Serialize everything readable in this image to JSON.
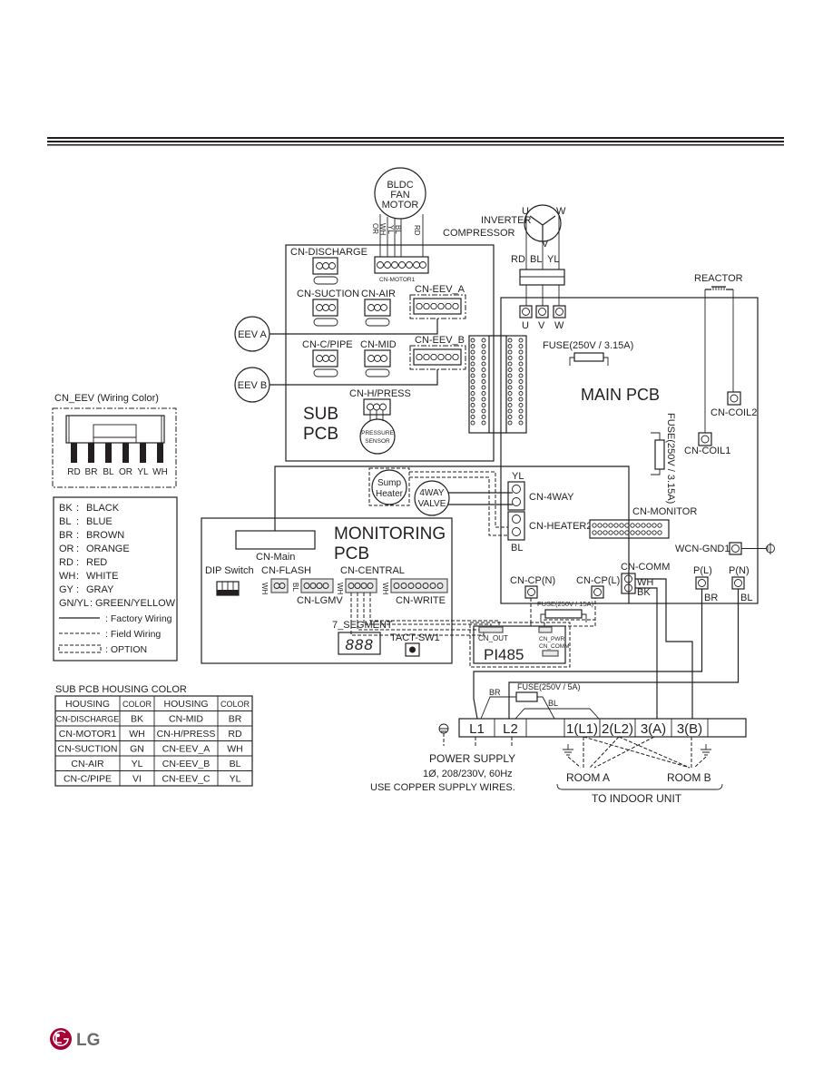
{
  "fan_motor": {
    "l1": "BLDC",
    "l2": "FAN",
    "l3": "MOTOR",
    "wires": [
      "OR",
      "WH",
      "YL",
      "BL",
      "RD"
    ]
  },
  "compressor": {
    "l1": "INVERTER",
    "l2": "COMPRESSOR",
    "u": "U",
    "v": "V",
    "w": "W",
    "wires": [
      "RD",
      "BL",
      "YL"
    ],
    "terminals": [
      "U",
      "V",
      "W"
    ]
  },
  "sub_pcb": {
    "title1": "SUB",
    "title2": "PCB",
    "cn_discharge": "CN-DISCHARGE",
    "cn_motor1": "CN-MOTOR1",
    "cn_suction": "CN-SUCTION",
    "cn_air": "CN-AIR",
    "cn_eev_a": "CN-EEV_A",
    "cn_cpipe": "CN-C/PIPE",
    "cn_mid": "CN-MID",
    "cn_eev_b": "CN-EEV_B",
    "cn_hpress": "CN-H/PRESS",
    "pressure1": "PRESSURE",
    "pressure2": "SENSOR"
  },
  "eev": {
    "a": "EEV A",
    "b": "EEV B"
  },
  "main_pcb": {
    "title": "MAIN PCB",
    "fuse1": "FUSE(250V / 3.15A)",
    "fuse2": "FUSE(250V / 3.15A)",
    "reactor": "REACTOR",
    "cn_coil1": "CN-COIL1",
    "cn_coil2": "CN-COIL2",
    "cn_4way": "CN-4WAY",
    "cn_heater2": "CN-HEATER2",
    "yl": "YL",
    "bl": "BL",
    "cn_monitor": "CN-MONITOR",
    "wcn_gnd1": "WCN-GND1",
    "cn_cpn": "CN-CP(N)",
    "cn_cpl": "CN-CP(L)",
    "fuse3": "FUSE(250V / 15A)",
    "cn_comm": "CN-COMM",
    "wh": "WH",
    "bk": "BK",
    "pl": "P(L)",
    "pn": "P(N)",
    "br": "BR",
    "bl2": "BL"
  },
  "sump": {
    "l1": "Sump",
    "l2": "Heater"
  },
  "valve": {
    "l1": "4WAY",
    "l2": "VALVE"
  },
  "monitoring_pcb": {
    "title1": "MONITORING",
    "title2": "PCB",
    "cn_main": "CN-Main",
    "dip": "DIP Switch",
    "cn_flash": "CN-FLASH",
    "cn_lgmv": "CN-LGMV",
    "cn_central": "CN-CENTRAL",
    "cn_write": "CN-WRITE",
    "wh": "WH",
    "bl": "BL",
    "seg_label": "7_SEGMENT",
    "seg_display": "888",
    "tact": "TACT-SW1"
  },
  "pi485": {
    "title": "PI485",
    "cn_out": "CN_OUT",
    "cn_pwr": "CN_PWR",
    "cn_comm": "CN_COMM"
  },
  "terminal": {
    "cells": [
      "L1",
      "L2",
      "",
      "1(L1)",
      "2(L2)",
      "3(A)",
      "3(B)",
      ""
    ],
    "fuse": "FUSE(250V / 5A)",
    "br": "BR",
    "bl": "BL",
    "power1": "POWER SUPPLY",
    "power2": "1Ø, 208/230V, 60Hz",
    "power3": "USE COPPER SUPPLY WIRES.",
    "room_a": "ROOM A",
    "room_b": "ROOM B",
    "indoor": "TO INDOOR UNIT"
  },
  "cn_eev_legend": {
    "title": "CN_EEV (Wiring Color)",
    "wires": [
      "RD",
      "BR",
      "BL",
      "OR",
      "YL",
      "WH"
    ]
  },
  "color_legend": [
    {
      "code": "BK",
      "name": "BLACK"
    },
    {
      "code": "BL",
      "name": "BLUE"
    },
    {
      "code": "BR",
      "name": "BROWN"
    },
    {
      "code": "OR",
      "name": "ORANGE"
    },
    {
      "code": "RD",
      "name": "RED"
    },
    {
      "code": "WH",
      "name": "WHITE"
    },
    {
      "code": "GY",
      "name": "GRAY"
    },
    {
      "code": "GN/YL",
      "name": "GREEN/YELLOW"
    }
  ],
  "line_legend": {
    "factory": ": Factory Wiring",
    "field": ": Field Wiring",
    "option": ": OPTION"
  },
  "housing_table": {
    "title": "SUB PCB HOUSING COLOR",
    "headers": [
      "HOUSING",
      "COLOR",
      "HOUSING",
      "COLOR"
    ],
    "rows": [
      [
        "CN-DISCHARGE",
        "BK",
        "CN-MID",
        "BR"
      ],
      [
        "CN-MOTOR1",
        "WH",
        "CN-H/PRESS",
        "RD"
      ],
      [
        "CN-SUCTION",
        "GN",
        "CN-EEV_A",
        "WH"
      ],
      [
        "CN-AIR",
        "YL",
        "CN-EEV_B",
        "BL"
      ],
      [
        "CN-C/PIPE",
        "VI",
        "CN-EEV_C",
        "YL"
      ]
    ]
  },
  "logo": {
    "text": "LG",
    "color": "#a50034"
  }
}
